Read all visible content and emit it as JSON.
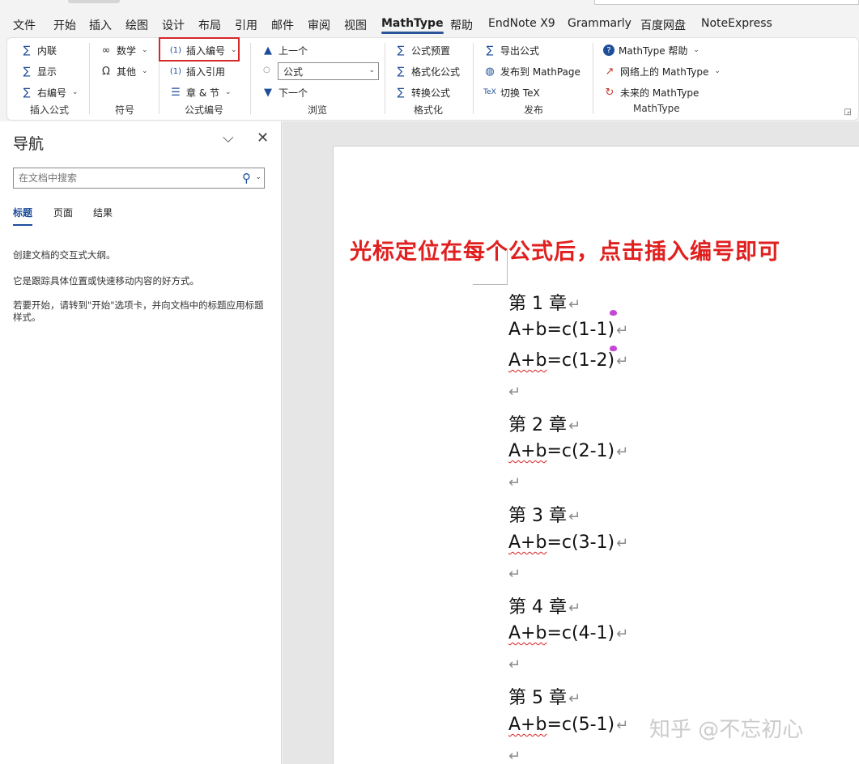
{
  "menu": {
    "tabs": [
      "文件",
      "开始",
      "插入",
      "绘图",
      "设计",
      "布局",
      "引用",
      "邮件",
      "审阅",
      "视图",
      "MathType",
      "帮助",
      "EndNote X9",
      "Grammarly",
      "百度网盘",
      "NoteExpress"
    ],
    "active_tab": "MathType"
  },
  "ribbon": {
    "insert_formula": {
      "inline": "内联",
      "display": "显示",
      "right_number": "右编号",
      "label": "插入公式"
    },
    "symbols": {
      "math": "数学",
      "other": "其他",
      "label": "符号"
    },
    "numbering": {
      "insert_number": "插入编号",
      "insert_reference": "插入引用",
      "chapter_section": "章 & 节",
      "label": "公式编号"
    },
    "browse": {
      "prev": "上一个",
      "dropdown_value": "公式",
      "next": "下一个",
      "label": "浏览"
    },
    "format": {
      "presets": "公式预置",
      "format_formula": "格式化公式",
      "convert": "转换公式",
      "label": "格式化"
    },
    "publish": {
      "export": "导出公式",
      "publish_mathpage": "发布到 MathPage",
      "toggle_tex": "切换 TeX",
      "label": "发布"
    },
    "mathtype": {
      "help": "MathType 帮助",
      "online": "网络上的 MathType",
      "future": "未来的 MathType",
      "label": "MathType"
    }
  },
  "nav": {
    "title": "导航",
    "search_placeholder": "在文档中搜索",
    "tabs": [
      "标题",
      "页面",
      "结果"
    ],
    "active_tab": "标题",
    "info1": "创建文档的交互式大纲。",
    "info2": "它是跟踪具体位置或快速移动内容的好方式。",
    "info3": "若要开始，请转到\"开始\"选项卡，并向文档中的标题应用标题样式。"
  },
  "document": {
    "annotation": "光标定位在每个公式后，点击插入编号即可",
    "lines": [
      {
        "type": "heading",
        "text": "第 1 章"
      },
      {
        "type": "eq",
        "text": "A+b=c(1-1)",
        "wavy": false
      },
      {
        "type": "eq",
        "text": "A+b=c(1-2)",
        "wavy": true
      },
      {
        "type": "empty"
      },
      {
        "type": "heading",
        "text": "第 2 章"
      },
      {
        "type": "eq",
        "text": "A+b=c(2-1)",
        "wavy": true
      },
      {
        "type": "empty"
      },
      {
        "type": "heading",
        "text": "第 3 章"
      },
      {
        "type": "eq",
        "text": "A+b=c(3-1)",
        "wavy": true
      },
      {
        "type": "empty"
      },
      {
        "type": "heading",
        "text": "第 4 章"
      },
      {
        "type": "eq",
        "text": "A+b=c(4-1)",
        "wavy": true
      },
      {
        "type": "empty"
      },
      {
        "type": "heading",
        "text": "第 5 章"
      },
      {
        "type": "eq",
        "text": "A+b=c(5-1)",
        "wavy": true
      },
      {
        "type": "empty"
      }
    ],
    "paragraph_mark": "↵"
  },
  "watermark": "知乎 @不忘初心",
  "colors": {
    "accent": "#2b579a",
    "annotation": "#e0201f",
    "highlight_box": "#d6282a"
  }
}
